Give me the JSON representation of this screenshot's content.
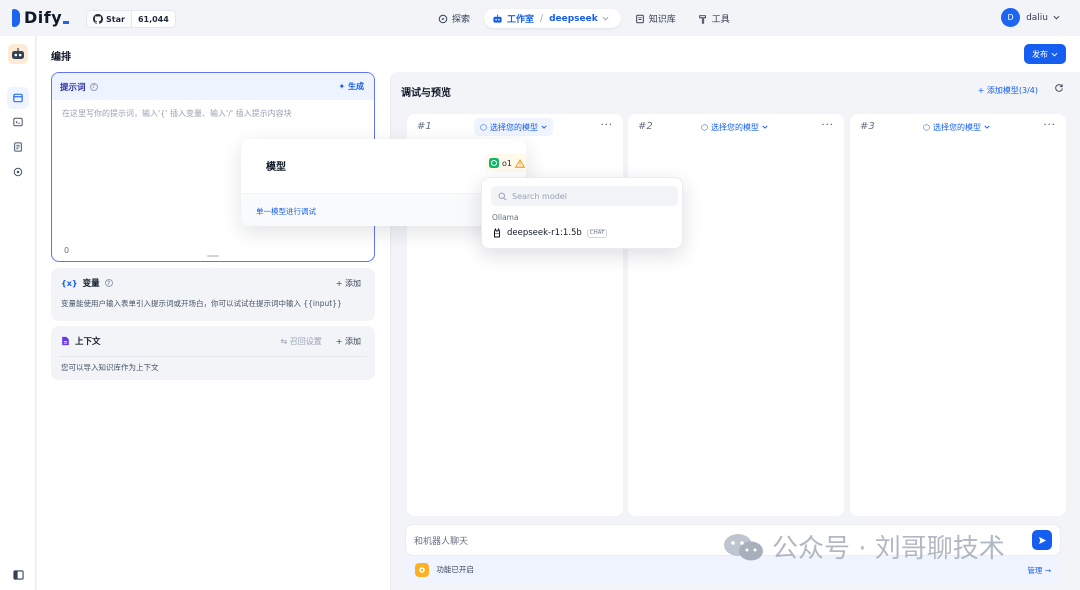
{
  "brand": {
    "name": "Dify",
    "accent": "#155eef"
  },
  "github": {
    "label": "Star",
    "count": "61,044"
  },
  "nav": {
    "explore": "探索",
    "studio": "工作室",
    "app_name": "deepseek",
    "knowledge": "知识库",
    "tools": "工具"
  },
  "user": {
    "initial": "D",
    "name": "daliu"
  },
  "page": {
    "title": "编排",
    "publish": "发布"
  },
  "prompt": {
    "title": "提示词",
    "generate": "生成",
    "placeholder": "在这里写你的提示词，输入'{' 插入变量、输入'/' 插入提示内容块",
    "count": "0"
  },
  "variables": {
    "title": "变量",
    "add": "添加",
    "desc": "变量能使用户输入表单引入提示词或开场白，你可以试试在提示词中输入 {{input}}"
  },
  "context": {
    "title": "上下文",
    "recall": "召回设置",
    "add": "添加",
    "desc": "您可以导入知识库作为上下文"
  },
  "debug": {
    "title": "调试与预览",
    "add_model": "添加模型(3/4)",
    "panels": [
      {
        "num": "#1",
        "select": "选择您的模型"
      },
      {
        "num": "#2",
        "select": "选择您的模型"
      },
      {
        "num": "#3",
        "select": "选择您的模型"
      }
    ],
    "chat_placeholder": "和机器人聊天",
    "feature_text": "功能已开启",
    "manage": "管理"
  },
  "model_popup": {
    "title": "模型",
    "current_model": "o1",
    "single_debug": "单一模型进行调试"
  },
  "model_dropdown": {
    "search_placeholder": "Search model",
    "group": "Ollama",
    "item": "deepseek-r1:1.5b",
    "tag": "CHAT"
  },
  "watermark": {
    "text": "公众号 · 刘哥聊技术"
  }
}
